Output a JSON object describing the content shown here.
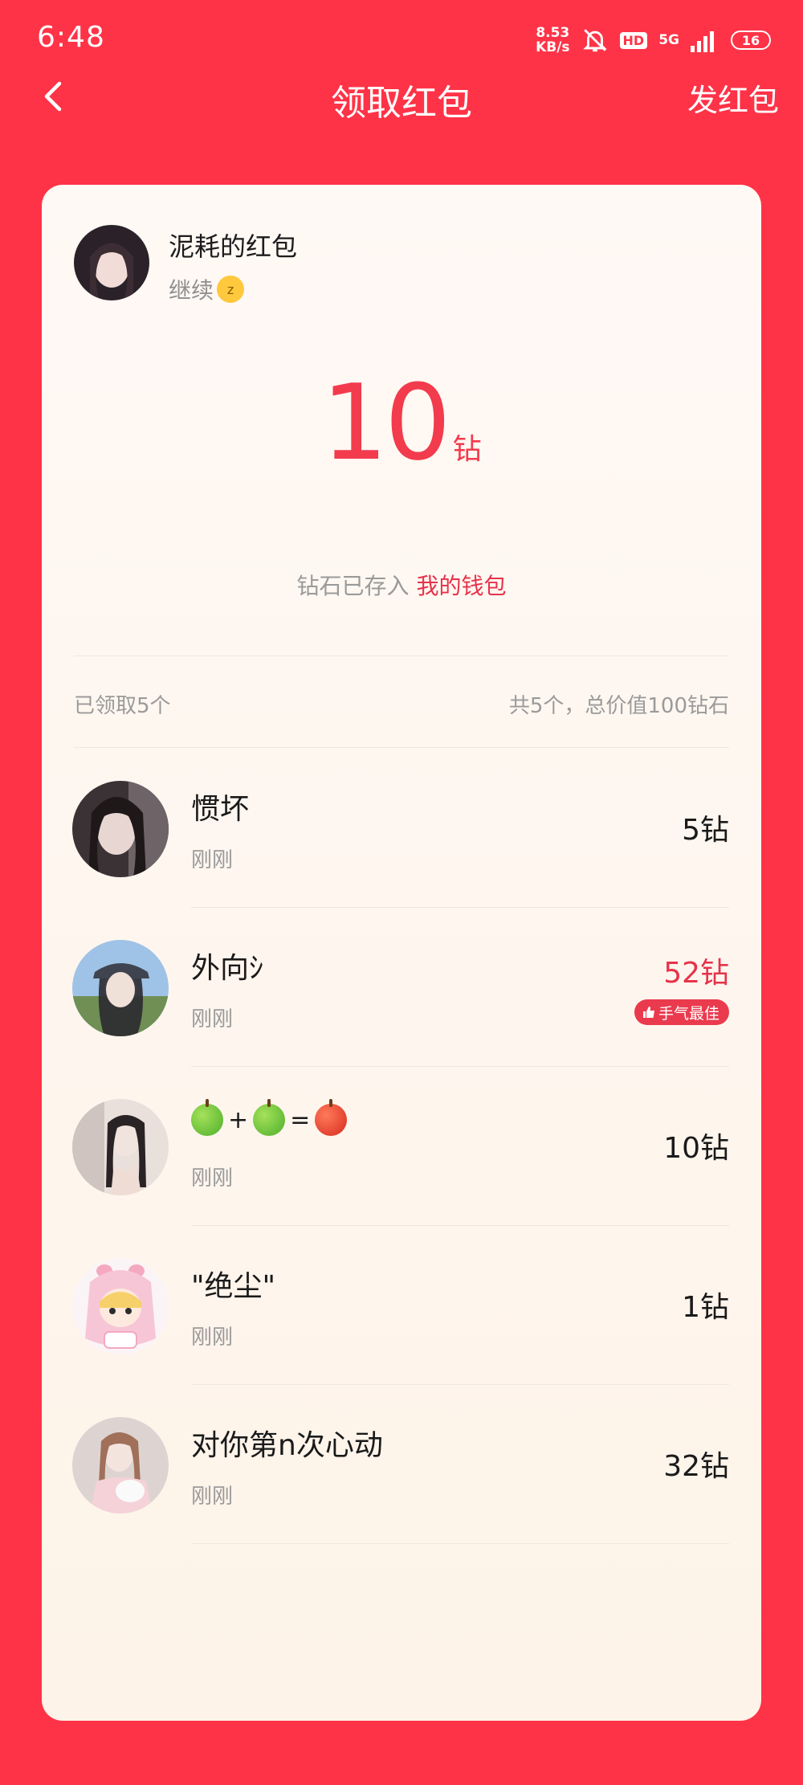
{
  "status_bar": {
    "time": "6:48",
    "net_speed_value": "8.53",
    "net_speed_unit": "KB/s",
    "hd": "HD",
    "network": "5G",
    "battery": "16"
  },
  "nav": {
    "title": "领取红包",
    "send_label": "发红包"
  },
  "sender": {
    "name": "泥耗的红包",
    "message": "继续",
    "message_emoji": "sleeping-face-icon"
  },
  "amount": {
    "value": "10",
    "unit": "钻"
  },
  "wallet_note": {
    "prefix": "钻石已存入",
    "link": "我的钱包"
  },
  "summary": {
    "claimed": "已领取5个",
    "total": "共5个，总价值100钻石"
  },
  "claims": [
    {
      "name": "惯坏",
      "time": "刚刚",
      "amount": "5钻"
    },
    {
      "name": "外向ｼ",
      "time": "刚刚",
      "amount": "52钻",
      "badge": "手气最佳"
    },
    {
      "name_parts": [
        "+",
        "="
      ],
      "time": "刚刚",
      "amount": "10钻"
    },
    {
      "name": "\"绝尘\"",
      "time": "刚刚",
      "amount": "1钻"
    },
    {
      "name": "对你第n次心动",
      "time": "刚刚",
      "amount": "32钻"
    }
  ],
  "colors": {
    "background": "#FF3347",
    "accent": "#E6334A",
    "card": "#FFF9F5"
  }
}
